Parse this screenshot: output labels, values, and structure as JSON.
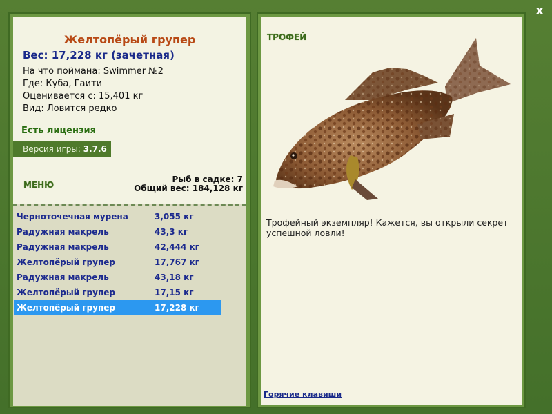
{
  "window": {
    "close_label": "x"
  },
  "fish": {
    "title": "Желтопёрый групер",
    "weight_line": "Вес: 17,228 кг (зачетная)",
    "bait_line": "На что поймана: Swimmer №2",
    "place_line": "Где: Куба, Гаити",
    "rated_line": "Оценивается с: 15,401 кг",
    "kind_line": "Вид: Ловится редко"
  },
  "license": "Есть лицензия",
  "version": {
    "label": "Версия игры: ",
    "value": "3.7.6"
  },
  "menu_label": "МЕНЮ",
  "keep": {
    "count_line": "Рыб в садке: 7",
    "weight_line": "Общий вес: 184,128 кг"
  },
  "catches": [
    {
      "name": "Черноточечная мурена",
      "weight": "3,055 кг"
    },
    {
      "name": "Радужная макрель",
      "weight": "43,3 кг"
    },
    {
      "name": "Радужная макрель",
      "weight": "42,444 кг"
    },
    {
      "name": "Желтопёрый групер",
      "weight": "17,767 кг"
    },
    {
      "name": "Радужная макрель",
      "weight": "43,18 кг"
    },
    {
      "name": "Желтопёрый групер",
      "weight": "17,15 кг"
    },
    {
      "name": "Желтопёрый групер",
      "weight": "17,228 кг"
    }
  ],
  "selected_index": 6,
  "trophy": {
    "label": "ТРОФЕЙ",
    "text": "Трофейный экземпляр! Кажется, вы открыли секрет успешной ловли!"
  },
  "hotkeys_label": "Горячие клавиши",
  "colors": {
    "frame_green": "#4a7a2c",
    "title_orange": "#b84a16",
    "text_blue": "#1c2a8e",
    "selection_blue": "#2c98f0"
  }
}
